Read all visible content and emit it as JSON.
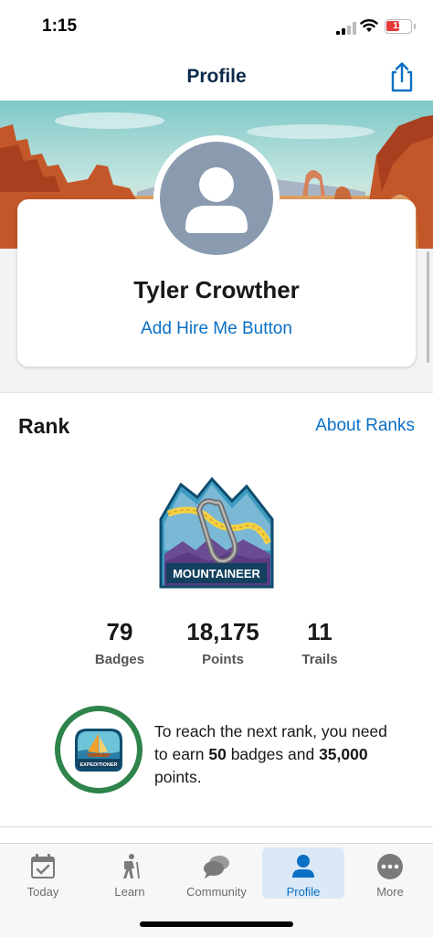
{
  "status_bar": {
    "time": "1:15",
    "battery": "11"
  },
  "nav": {
    "title": "Profile",
    "share_icon": "share-icon"
  },
  "profile": {
    "name": "Tyler Crowther",
    "hire_link": "Add Hire Me Button"
  },
  "rank": {
    "title": "Rank",
    "about_link": "About Ranks",
    "badge_label": "MOUNTAINEER",
    "stats": [
      {
        "value": "79",
        "label": "Badges"
      },
      {
        "value": "18,175",
        "label": "Points"
      },
      {
        "value": "11",
        "label": "Trails"
      }
    ],
    "next_badge_label": "EXPEDITIONER",
    "next_rank": {
      "prefix": "To reach the next rank, you need to earn",
      "badges_needed": "50",
      "middle": "badges and",
      "points_needed": "35,000",
      "suffix": "points."
    }
  },
  "tabs": [
    {
      "label": "Today",
      "icon": "calendar-check-icon",
      "active": false
    },
    {
      "label": "Learn",
      "icon": "hiker-icon",
      "active": false
    },
    {
      "label": "Community",
      "icon": "chat-bubbles-icon",
      "active": false
    },
    {
      "label": "Profile",
      "icon": "person-icon",
      "active": true
    },
    {
      "label": "More",
      "icon": "more-dots-icon",
      "active": false
    }
  ],
  "colors": {
    "accent": "#0b6fc4",
    "nav_title": "#0b2a4a",
    "progress": "#2e844a"
  }
}
